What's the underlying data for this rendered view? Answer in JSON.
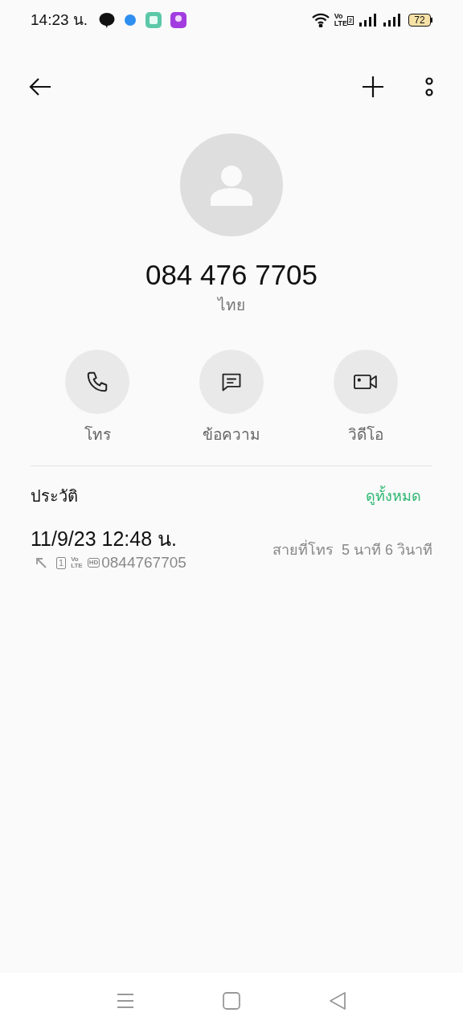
{
  "status_bar": {
    "time": "14:23 น.",
    "volte": {
      "top": "Vo",
      "bottom": "LTE",
      "sim": "2"
    },
    "battery": "72"
  },
  "contact": {
    "number": "084 476 7705",
    "location": "ไทย"
  },
  "actions": [
    {
      "kind": "call",
      "label": "โทร"
    },
    {
      "kind": "message",
      "label": "ข้อความ"
    },
    {
      "kind": "video",
      "label": "วิดีโอ"
    }
  ],
  "history": {
    "title": "ประวัติ",
    "view_all": "ดูทั้งหมด",
    "entries": [
      {
        "datetime": "11/9/23 12:48 น.",
        "sim": "1",
        "volte_top": "Vo",
        "volte_bottom": "LTE",
        "hd": "HD",
        "number": "0844767705",
        "type": "สายที่โทร",
        "duration": "5 นาที 6 วินาที"
      }
    ]
  }
}
